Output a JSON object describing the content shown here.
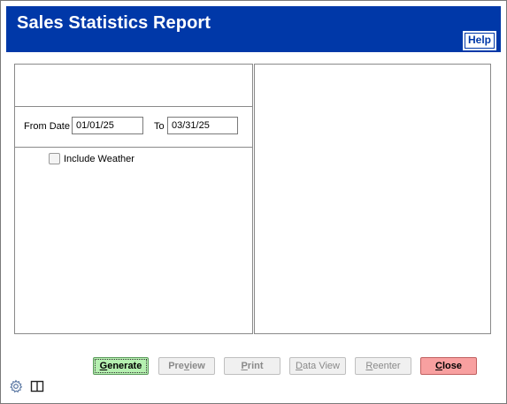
{
  "window": {
    "title": "Sales Statistics Report"
  },
  "header": {
    "help_label": "Help"
  },
  "filters": {
    "from_date_label": "From Date",
    "from_date_value": "01/01/25",
    "to_label": "To",
    "to_date_value": "03/31/25",
    "include_weather_label": "Include Weather",
    "include_weather_checked": false
  },
  "buttons": {
    "generate": {
      "pre": "",
      "key": "G",
      "post": "enerate"
    },
    "preview": {
      "pre": "Pre",
      "key": "v",
      "post": "iew"
    },
    "print": {
      "pre": "",
      "key": "P",
      "post": "rint"
    },
    "data_view": {
      "pre": "",
      "key": "D",
      "post": "ata View"
    },
    "reenter": {
      "pre": "",
      "key": "R",
      "post": "eenter"
    },
    "close": {
      "pre": "",
      "key": "C",
      "post": "lose"
    }
  },
  "icons": {
    "settings": "gear-icon",
    "layout": "book-icon"
  },
  "colors": {
    "title_bar": "#0038a8",
    "generate_bg": "#b5f0b0",
    "close_bg": "#f8a0a0"
  }
}
